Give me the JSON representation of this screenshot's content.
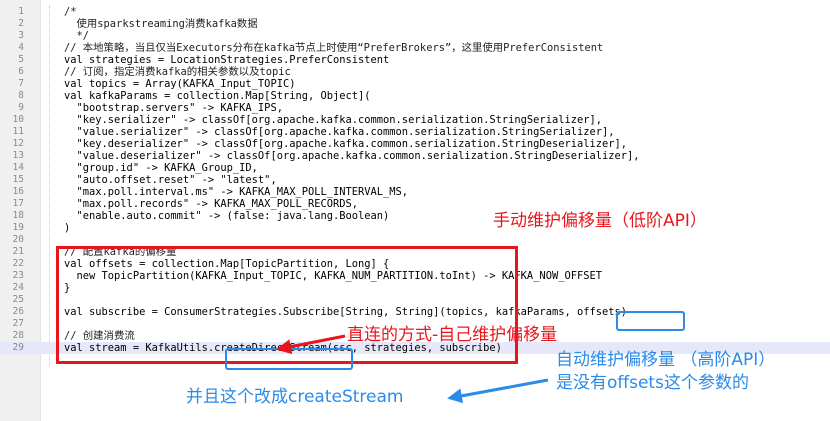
{
  "editor": {
    "lines": [
      {
        "n": "1",
        "text": "/*",
        "comment": true
      },
      {
        "n": "2",
        "text": "  使用sparkstreaming消费kafka数据",
        "comment": true
      },
      {
        "n": "3",
        "text": "  */",
        "comment": true
      },
      {
        "n": "4",
        "text": "// 本地策略，当且仅当Executors分布在kafka节点上时使用“PreferBrokers”，这里使用PreferConsistent",
        "comment": true
      },
      {
        "n": "5",
        "text": "val strategies = LocationStrategies.PreferConsistent"
      },
      {
        "n": "6",
        "text": "// 订阅，指定消费kafka的相关参数以及topic",
        "comment": true
      },
      {
        "n": "7",
        "text": "val topics = Array(KAFKA_Input_TOPIC)"
      },
      {
        "n": "8",
        "text": "val kafkaParams = collection.Map[String, Object]("
      },
      {
        "n": "9",
        "text": "  \"bootstrap.servers\" -> KAFKA_IPS,"
      },
      {
        "n": "10",
        "text": "  \"key.serializer\" -> classOf[org.apache.kafka.common.serialization.StringSerializer],"
      },
      {
        "n": "11",
        "text": "  \"value.serializer\" -> classOf[org.apache.kafka.common.serialization.StringSerializer],"
      },
      {
        "n": "12",
        "text": "  \"key.deserializer\" -> classOf[org.apache.kafka.common.serialization.StringDeserializer],"
      },
      {
        "n": "13",
        "text": "  \"value.deserializer\" -> classOf[org.apache.kafka.common.serialization.StringDeserializer],"
      },
      {
        "n": "14",
        "text": "  \"group.id\" -> KAFKA_Group_ID,"
      },
      {
        "n": "15",
        "text": "  \"auto.offset.reset\" -> \"latest\","
      },
      {
        "n": "16",
        "text": "  \"max.poll.interval.ms\" -> KAFKA_MAX_POLL_INTERVAL_MS,"
      },
      {
        "n": "17",
        "text": "  \"max.poll.records\" -> KAFKA_MAX_POLL_RECORDS,"
      },
      {
        "n": "18",
        "text": "  \"enable.auto.commit\" -> (false: java.lang.Boolean)"
      },
      {
        "n": "19",
        "text": ")"
      },
      {
        "n": "20",
        "text": ""
      },
      {
        "n": "21",
        "text": "// 配置kafka的偏移量",
        "comment": true
      },
      {
        "n": "22",
        "text": "val offsets = collection.Map[TopicPartition, Long] {"
      },
      {
        "n": "23",
        "text": "  new TopicPartition(KAFKA_Input_TOPIC, KAFKA_NUM_PARTITION.toInt) -> KAFKA_NOW_OFFSET"
      },
      {
        "n": "24",
        "text": "}"
      },
      {
        "n": "25",
        "text": ""
      },
      {
        "n": "26",
        "text": "val subscribe = ConsumerStrategies.Subscribe[String, String](topics, kafkaParams, offsets)"
      },
      {
        "n": "27",
        "text": ""
      },
      {
        "n": "28",
        "text": "// 创建消费流",
        "comment": true
      },
      {
        "n": "29",
        "text": "val stream = KafkaUtils.createDirectStream(ssc, strategies, subscribe)",
        "current": true
      }
    ]
  },
  "annotations": {
    "manual_offset": "手动维护偏移量（低阶API）",
    "direct_mode": "直连的方式-自己维护偏移量",
    "auto_offset": "自动维护偏移量 （高阶API）",
    "no_offsets_param": "是没有offsets这个参数的",
    "change_to_create": "并且这个改成createStream"
  },
  "colors": {
    "red": "#e8161c",
    "blue": "#2a8be8",
    "current_line": "#e6e8fa",
    "gutter": "#f0f0f0"
  }
}
